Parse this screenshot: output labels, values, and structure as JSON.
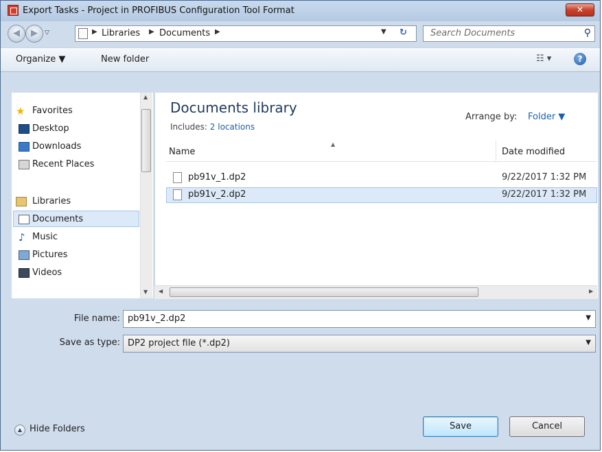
{
  "window": {
    "title": "Export Tasks - Project in PROFIBUS Configuration Tool Format",
    "close_label": "✕"
  },
  "address_bar": {
    "crumbs": [
      "Libraries",
      "Documents"
    ],
    "search_placeholder": "Search Documents"
  },
  "toolbar": {
    "organize_label": "Organize ▼",
    "new_folder_label": "New folder"
  },
  "sidebar": {
    "items": [
      {
        "label": "Favorites",
        "icon": "star-icon"
      },
      {
        "label": "Desktop",
        "icon": "desktop-icon"
      },
      {
        "label": "Downloads",
        "icon": "downloads-icon"
      },
      {
        "label": "Recent Places",
        "icon": "recent-places-icon"
      },
      {
        "label": "Libraries",
        "icon": "libraries-icon"
      },
      {
        "label": "Documents",
        "icon": "documents-icon"
      },
      {
        "label": "Music",
        "icon": "music-icon"
      },
      {
        "label": "Pictures",
        "icon": "pictures-icon"
      },
      {
        "label": "Videos",
        "icon": "videos-icon"
      }
    ],
    "selected": "Documents"
  },
  "content": {
    "library_title": "Documents library",
    "includes_prefix": "Includes: ",
    "includes_link": "2 locations",
    "arrange_label": "Arrange by:",
    "arrange_value": "Folder ▼",
    "columns": {
      "name": "Name",
      "date": "Date modified"
    },
    "files": [
      {
        "name": "pb91v_1.dp2",
        "date": "9/22/2017 1:32 PM",
        "selected": false
      },
      {
        "name": "pb91v_2.dp2",
        "date": "9/22/2017 1:32 PM",
        "selected": true
      }
    ]
  },
  "form": {
    "filename_label": "File name:",
    "filename_value": "pb91v_2.dp2",
    "savetype_label": "Save as type:",
    "savetype_value": "DP2 project file (*.dp2)"
  },
  "footer": {
    "hide_folders_label": "Hide Folders",
    "save_label": "Save",
    "cancel_label": "Cancel"
  },
  "colors": {
    "accent": "#1a5fb0",
    "selection": "#dbe9f8",
    "close": "#c8412c"
  }
}
